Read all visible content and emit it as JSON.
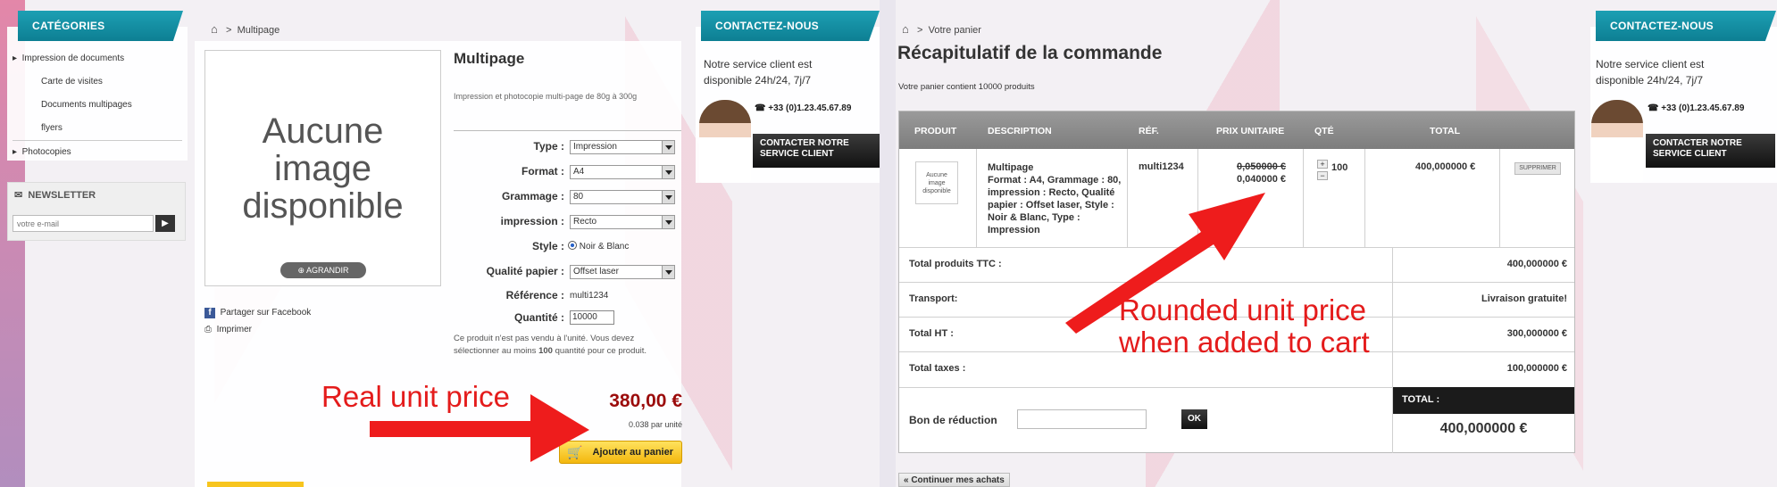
{
  "left": {
    "categories": {
      "title": "Catégories",
      "items": [
        {
          "label": "Impression de documents"
        },
        {
          "label": "Carte de visites"
        },
        {
          "label": "Documents multipages"
        },
        {
          "label": "flyers"
        },
        {
          "label": "Photocopies"
        }
      ]
    },
    "newsletter": {
      "title": "Newsletter",
      "placeholder": "votre e-mail"
    },
    "breadcrumb": {
      "home": "⌂",
      "sep": ">",
      "current": "Multipage"
    },
    "image_placeholder": "Aucune image disponible",
    "enlarge": "Agrandir",
    "share_facebook": "Partager sur Facebook",
    "print": "Imprimer",
    "product": {
      "title": "Multipage",
      "desc": "Impression et photocopie multi-page de 80g à 300g",
      "fields": [
        {
          "label": "Type :",
          "value": "Impression",
          "kind": "select"
        },
        {
          "label": "Format :",
          "value": "A4",
          "kind": "select"
        },
        {
          "label": "Grammage :",
          "value": "80",
          "kind": "select"
        },
        {
          "label": "impression :",
          "value": "Recto",
          "kind": "select"
        },
        {
          "label": "Style :",
          "value": "Noir & Blanc",
          "kind": "radio"
        },
        {
          "label": "Qualité papier :",
          "value": "Offset laser",
          "kind": "select"
        },
        {
          "label": "Référence :",
          "value": "multi1234",
          "kind": "text"
        },
        {
          "label": "Quantité :",
          "value": "10000",
          "kind": "input"
        }
      ],
      "min_note_prefix": "Ce produit n'est pas vendu à l'unité. Vous devez sélectionner au moins",
      "min_qty": "100",
      "min_note_suffix": "quantité pour ce produit.",
      "price": "380,00 €",
      "unit_price": "0.038 par unité",
      "add_to_cart": "Ajouter au panier"
    },
    "contact": {
      "title": "Contactez-nous",
      "text": "Notre service client est disponible 24h/24, 7j/7",
      "phone": "+33 (0)1.23.45.67.89",
      "button": "Contacter notre service client"
    },
    "annotation": "Real unit price"
  },
  "right": {
    "breadcrumb": {
      "home": "⌂",
      "sep": ">",
      "current": "Votre panier"
    },
    "title": "Récapitulatif de la commande",
    "subtitle": "Votre panier contient 10000 produits",
    "columns": [
      "Produit",
      "Description",
      "Réf.",
      "Prix unitaire",
      "Qté",
      "Total"
    ],
    "item": {
      "thumb": "Aucune image disponible",
      "name": "Multipage",
      "details": "Format : A4, Grammage : 80, impression : Recto, Qualité papier : Offset laser, Style : Noir & Blanc, Type : Impression",
      "ref": "multi1234",
      "old_price": "0,050000 €",
      "price": "0,040000 €",
      "qty": "100",
      "total": "400,000000 €",
      "delete": "Supprimer"
    },
    "summary": [
      {
        "label": "Total produits TTC :",
        "value": "400,000000 €"
      },
      {
        "label": "Transport:",
        "value": "Livraison gratuite!"
      },
      {
        "label": "Total HT :",
        "value": "300,000000 €"
      },
      {
        "label": "Total taxes :",
        "value": "100,000000 €"
      }
    ],
    "voucher": {
      "label": "Bon de réduction",
      "button": "OK"
    },
    "total": {
      "label": "Total :",
      "value": "400,000000 €"
    },
    "continue": "« Continuer mes achats",
    "contact": {
      "title": "Contactez-nous",
      "text": "Notre service client est disponible 24h/24, 7j/7",
      "phone": "+33 (0)1.23.45.67.89",
      "button": "Contacter notre service client"
    },
    "annotation_line1": "Rounded unit price",
    "annotation_line2": "when added to cart"
  },
  "colors": {
    "accent": "#1597ab",
    "price": "#9b0b0b",
    "arrow": "#ee1c1c",
    "cart_button": "#f7c51e"
  }
}
